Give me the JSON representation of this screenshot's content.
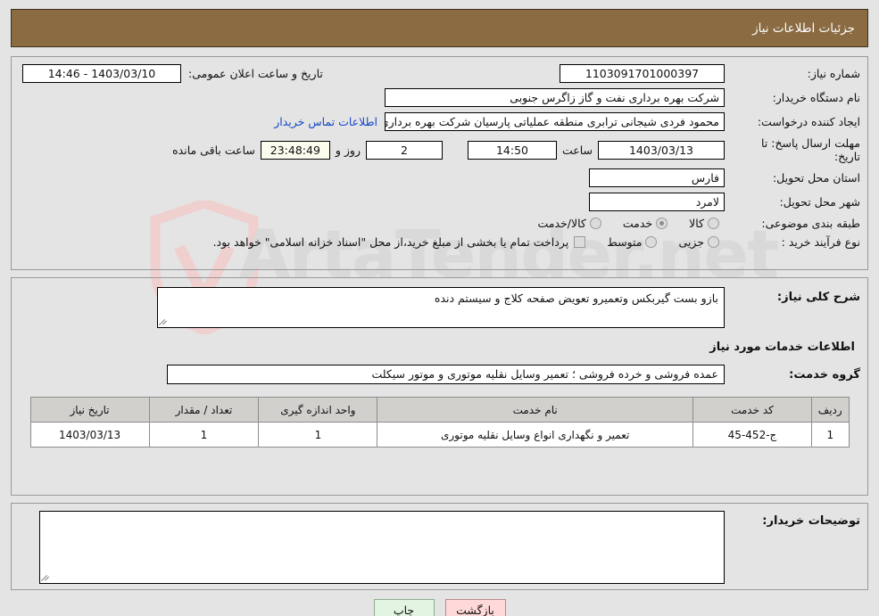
{
  "header": {
    "title": "جزئیات اطلاعات نیاز"
  },
  "colors": {
    "header_bg": "#8a6b42",
    "page_bg": "#e4e4e4",
    "link": "#1448c8",
    "table_header_bg": "#d2d0cd",
    "back_button_bg": "#ffd9d9",
    "print_button_bg": "#e2f4e2",
    "remaining_field_bg": "#fbfbee"
  },
  "watermark": {
    "text": "ArtaTender.net"
  },
  "top_section": {
    "need_number": {
      "label": "شماره نیاز:",
      "value": "1103091701000397"
    },
    "announce": {
      "label": "تاریخ و ساعت اعلان عمومی:",
      "value": "14:46 - 1403/03/10"
    },
    "buyer_org": {
      "label": "نام دستگاه خریدار:",
      "value": "شرکت بهره برداری نفت و گاز زاگرس جنوبی"
    },
    "requester": {
      "label": "ایجاد کننده درخواست:",
      "value": "محمود فردی شیجانی ترابری منطقه عملیاتی پارسیان شرکت بهره برداری نفت و",
      "contact_link": "اطلاعات تماس خریدار"
    },
    "deadline": {
      "label_line1": "مهلت ارسال پاسخ: تا",
      "label_line2": "تاریخ:",
      "date": "1403/03/13",
      "hour_label": "ساعت",
      "hour": "14:50",
      "days": "2",
      "days_label": "روز و",
      "remaining": "23:48:49",
      "remaining_label": "ساعت باقی مانده"
    },
    "province": {
      "label": "استان محل تحویل:",
      "value": "فارس"
    },
    "city": {
      "label": "شهر محل تحویل:",
      "value": "لامرد"
    },
    "category": {
      "label": "طبقه بندی موضوعی:",
      "options": [
        "کالا",
        "خدمت",
        "کالا/خدمت"
      ],
      "selected": "خدمت"
    },
    "process_type": {
      "label": "نوع فرآیند خرید :",
      "options": [
        "جزیی",
        "متوسط"
      ],
      "selected": "",
      "treasury_note": "پرداخت تمام یا بخشی از مبلغ خرید،از محل \"اسناد خزانه اسلامی\" خواهد بود."
    }
  },
  "mid_section": {
    "description": {
      "label": "شرح کلی نیاز:",
      "value": "بازو بست گیربکس وتعمیرو تعویض صفحه کلاج و سیستم دنده"
    },
    "services_title": "اطلاعات خدمات مورد نیاز",
    "service_group": {
      "label": "گروه خدمت:",
      "value": "عمده فروشی و خرده فروشی ؛ تعمیر وسایل نقلیه موتوری و موتور سیکلت"
    },
    "table": {
      "columns": [
        "ردیف",
        "کد خدمت",
        "نام خدمت",
        "واحد اندازه گیری",
        "تعداد / مقدار",
        "تاریخ نیاز"
      ],
      "rows": [
        {
          "row_no": "1",
          "service_code": "ج-452-45",
          "service_name": "تعمیر و نگهداری انواع وسایل نقلیه موتوری",
          "unit": "1",
          "quantity": "1",
          "need_date": "1403/03/13"
        }
      ]
    }
  },
  "bottom_section": {
    "buyer_notes": {
      "label": "توضیحات خریدار:",
      "value": ""
    }
  },
  "footer": {
    "back_button": "بازگشت",
    "print_button": "چاپ"
  }
}
